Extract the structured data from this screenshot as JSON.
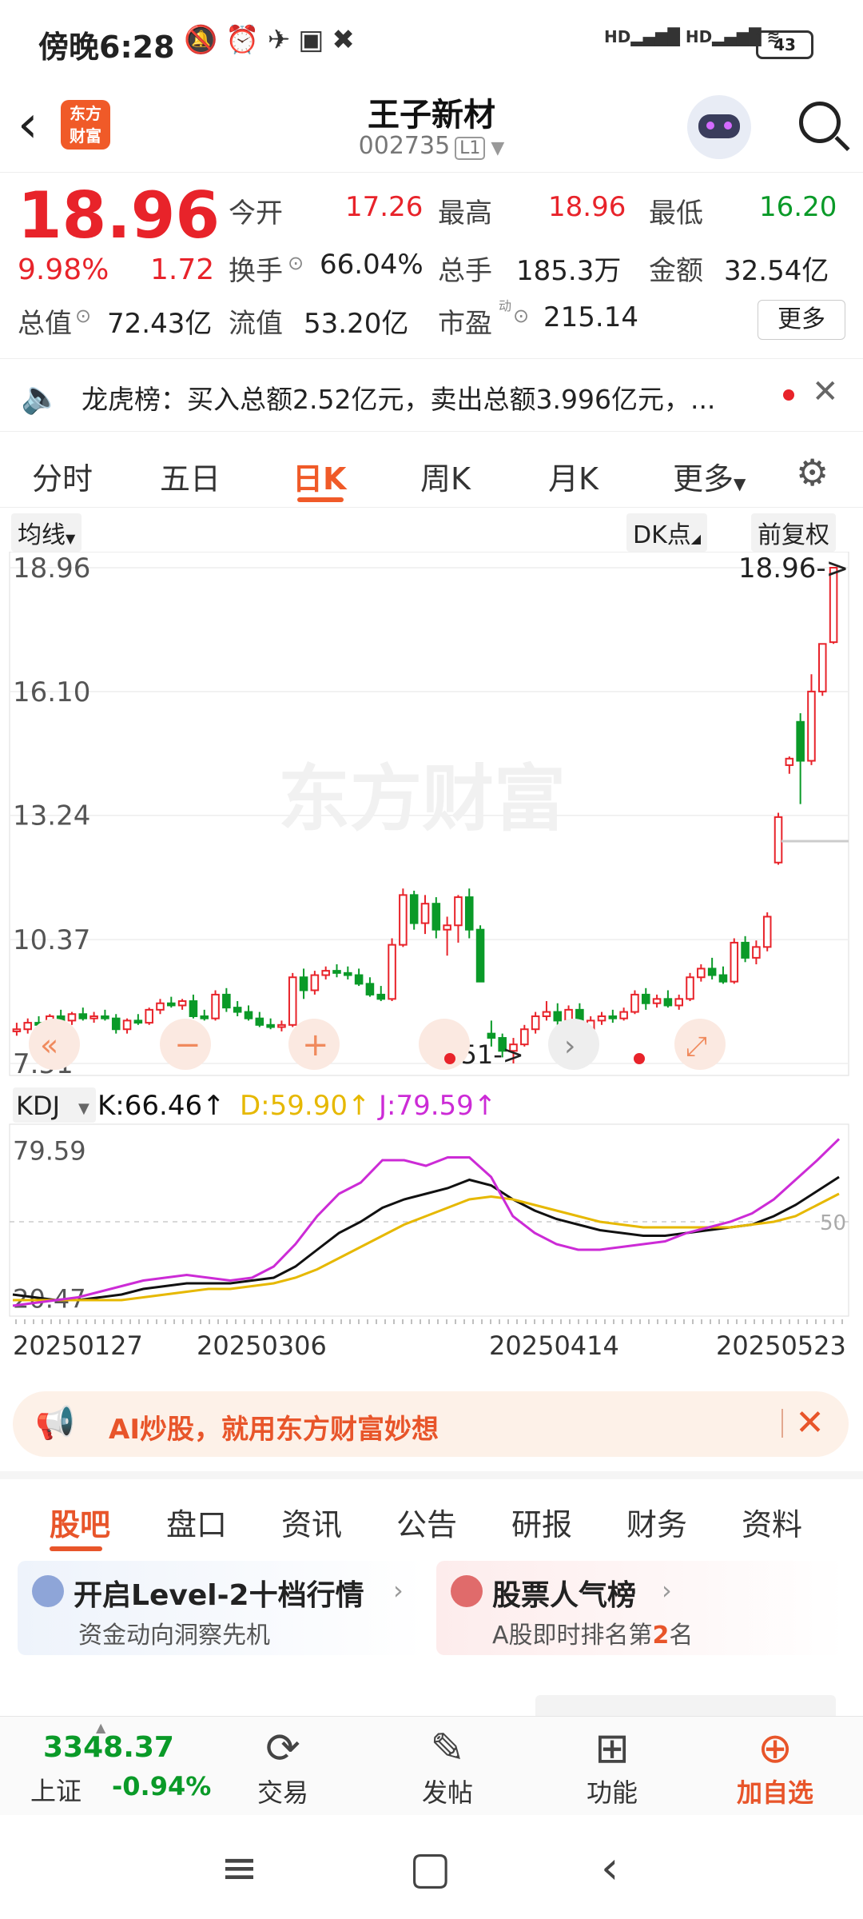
{
  "status_bar": {
    "time": "傍晚6:28",
    "battery": "43",
    "network": "HD HD"
  },
  "header": {
    "stock_name": "王子新材",
    "code": "002735",
    "level": "L1",
    "logo_text": "东方财富"
  },
  "quote": {
    "price": "18.96",
    "change_pct": "9.98%",
    "change": "1.72",
    "open_label": "今开",
    "open": "17.26",
    "high_label": "最高",
    "high": "18.96",
    "low_label": "最低",
    "low": "16.20",
    "turnover_label": "换手",
    "turnover": "66.04%",
    "volume_label": "总手",
    "volume": "185.3万",
    "amount_label": "金额",
    "amount": "32.54亿",
    "mktcap_label": "总值",
    "mktcap": "72.43亿",
    "float_label": "流值",
    "float": "53.20亿",
    "pe_label": "市盈",
    "pe_sup": "动",
    "pe": "215.14",
    "more_button": "更多"
  },
  "notice": {
    "text": "龙虎榜：买入总额2.52亿元，卖出总额3.996亿元，..."
  },
  "chart_tabs": [
    "分时",
    "五日",
    "日K",
    "周K",
    "月K",
    "更多"
  ],
  "active_chart_tab": "日K",
  "chart_controls": {
    "ma_button": "均线",
    "dk_button": "DK点",
    "adjust_button": "前复权"
  },
  "chart_data": [
    {
      "type": "candlestick",
      "y_ticks": [
        "18.96",
        "16.10",
        "13.24",
        "10.37",
        "7.51"
      ],
      "ylim": [
        7.51,
        18.96
      ],
      "max_marker": "18.96->",
      "min_marker": "7.51->",
      "watermark": "东方财富",
      "colors": {
        "up": "#e8232a",
        "down": "#0a9a28"
      },
      "candles": [
        [
          8.25,
          8.45,
          8.15,
          8.3
        ],
        [
          8.3,
          8.55,
          8.2,
          8.45
        ],
        [
          8.45,
          8.6,
          8.35,
          8.4
        ],
        [
          8.4,
          8.65,
          8.35,
          8.6
        ],
        [
          8.6,
          8.75,
          8.45,
          8.5
        ],
        [
          8.5,
          8.7,
          8.4,
          8.65
        ],
        [
          8.65,
          8.8,
          8.5,
          8.55
        ],
        [
          8.55,
          8.7,
          8.45,
          8.6
        ],
        [
          8.6,
          8.75,
          8.5,
          8.55
        ],
        [
          8.55,
          8.65,
          8.2,
          8.3
        ],
        [
          8.3,
          8.55,
          8.2,
          8.5
        ],
        [
          8.5,
          8.65,
          8.4,
          8.45
        ],
        [
          8.45,
          8.8,
          8.4,
          8.75
        ],
        [
          8.75,
          9.0,
          8.65,
          8.9
        ],
        [
          8.9,
          9.05,
          8.8,
          8.85
        ],
        [
          8.85,
          9.0,
          8.75,
          8.95
        ],
        [
          8.95,
          9.1,
          8.55,
          8.6
        ],
        [
          8.6,
          8.75,
          8.5,
          8.55
        ],
        [
          8.55,
          9.2,
          8.5,
          9.1
        ],
        [
          9.1,
          9.25,
          8.7,
          8.8
        ],
        [
          8.8,
          8.95,
          8.6,
          8.7
        ],
        [
          8.7,
          8.85,
          8.5,
          8.55
        ],
        [
          8.55,
          8.7,
          8.35,
          8.4
        ],
        [
          8.4,
          8.55,
          8.3,
          8.35
        ],
        [
          8.35,
          8.5,
          8.25,
          8.4
        ],
        [
          8.4,
          9.6,
          8.35,
          9.5
        ],
        [
          9.5,
          9.7,
          9.0,
          9.2
        ],
        [
          9.2,
          9.65,
          9.1,
          9.55
        ],
        [
          9.55,
          9.75,
          9.45,
          9.65
        ],
        [
          9.65,
          9.8,
          9.5,
          9.6
        ],
        [
          9.6,
          9.75,
          9.45,
          9.55
        ],
        [
          9.55,
          9.7,
          9.3,
          9.35
        ],
        [
          9.35,
          9.5,
          9.05,
          9.1
        ],
        [
          9.1,
          9.3,
          8.95,
          9.0
        ],
        [
          9.0,
          10.4,
          8.95,
          10.25
        ],
        [
          10.25,
          11.55,
          10.2,
          11.4
        ],
        [
          11.4,
          11.5,
          10.6,
          10.75
        ],
        [
          10.75,
          11.4,
          10.5,
          11.2
        ],
        [
          11.2,
          11.35,
          10.4,
          10.6
        ],
        [
          10.6,
          10.9,
          10.0,
          10.7
        ],
        [
          10.7,
          11.4,
          10.3,
          11.35
        ],
        [
          11.35,
          11.55,
          10.4,
          10.6
        ],
        [
          10.6,
          10.7,
          9.5,
          9.4
        ],
        [
          8.2,
          8.5,
          7.9,
          8.1
        ],
        [
          8.1,
          8.2,
          7.65,
          7.8
        ],
        [
          7.8,
          8.1,
          7.51,
          7.95
        ],
        [
          7.95,
          8.4,
          7.9,
          8.3
        ],
        [
          8.3,
          8.7,
          8.2,
          8.6
        ],
        [
          8.6,
          8.95,
          8.5,
          8.7
        ],
        [
          8.7,
          8.9,
          8.4,
          8.5
        ],
        [
          8.5,
          8.85,
          8.4,
          8.75
        ],
        [
          8.75,
          8.9,
          8.2,
          8.3
        ],
        [
          8.3,
          8.6,
          8.25,
          8.5
        ],
        [
          8.5,
          8.7,
          8.4,
          8.6
        ],
        [
          8.6,
          8.75,
          8.45,
          8.55
        ],
        [
          8.55,
          8.8,
          8.5,
          8.7
        ],
        [
          8.7,
          9.2,
          8.65,
          9.1
        ],
        [
          9.1,
          9.25,
          8.75,
          8.9
        ],
        [
          8.9,
          9.1,
          8.8,
          9.0
        ],
        [
          9.0,
          9.2,
          8.8,
          8.85
        ],
        [
          8.85,
          9.1,
          8.75,
          9.0
        ],
        [
          9.0,
          9.6,
          8.95,
          9.5
        ],
        [
          9.5,
          9.8,
          9.4,
          9.7
        ],
        [
          9.7,
          9.95,
          9.45,
          9.55
        ],
        [
          9.55,
          9.75,
          9.35,
          9.4
        ],
        [
          9.4,
          10.4,
          9.35,
          10.3
        ],
        [
          10.3,
          10.45,
          9.85,
          9.95
        ],
        [
          9.95,
          10.35,
          9.8,
          10.2
        ],
        [
          10.2,
          11.0,
          10.1,
          10.9
        ],
        [
          12.15,
          13.3,
          12.1,
          13.2
        ],
        [
          14.4,
          14.6,
          14.2,
          14.55
        ],
        [
          15.4,
          15.6,
          13.5,
          14.5
        ],
        [
          14.5,
          16.5,
          14.4,
          16.1
        ],
        [
          16.1,
          17.2,
          16.0,
          17.2
        ],
        [
          17.24,
          18.96,
          17.2,
          18.96
        ]
      ]
    },
    {
      "type": "line",
      "indicator": "KDJ",
      "y_ticks": [
        "79.59",
        "50",
        "20.47"
      ],
      "ylim": [
        18,
        82
      ],
      "x_ticks": [
        "20250127",
        "20250306",
        "20250414",
        "20250523"
      ],
      "series": [
        {
          "name": "K",
          "value_label": "K:66.46",
          "color": "#111111",
          "values": [
            24,
            23,
            22,
            22,
            23,
            24,
            26,
            27,
            28,
            28,
            28,
            29,
            30,
            34,
            40,
            46,
            50,
            55,
            58,
            60,
            62,
            65,
            63,
            58,
            54,
            51,
            49,
            47,
            46,
            45,
            45,
            46,
            47,
            48,
            49,
            52,
            56,
            61,
            66
          ]
        },
        {
          "name": "D",
          "value_label": "D:59.90",
          "color": "#e6b800",
          "values": [
            22,
            22,
            22,
            22,
            22,
            22,
            23,
            24,
            25,
            26,
            26,
            27,
            28,
            30,
            33,
            37,
            41,
            45,
            49,
            52,
            55,
            58,
            59,
            58,
            56,
            54,
            52,
            50,
            49,
            48,
            48,
            48,
            48,
            48,
            49,
            50,
            52,
            56,
            60
          ]
        },
        {
          "name": "J",
          "value_label": "J:79.59",
          "color": "#cc2bd6",
          "values": [
            20,
            21,
            22,
            23,
            25,
            27,
            29,
            30,
            31,
            30,
            29,
            30,
            34,
            42,
            52,
            60,
            64,
            72,
            72,
            70,
            73,
            73,
            66,
            52,
            46,
            42,
            40,
            40,
            41,
            42,
            43,
            46,
            48,
            50,
            53,
            58,
            65,
            72,
            79.59
          ]
        }
      ]
    }
  ],
  "ai_banner": {
    "text": "AI炒股，就用东方财富妙想"
  },
  "sub_tabs": [
    "股吧",
    "盘口",
    "资讯",
    "公告",
    "研报",
    "财务",
    "资料"
  ],
  "active_sub_tab": "股吧",
  "cards": [
    {
      "title": "开启Level-2十档行情",
      "subtitle": "资金动向洞察先机"
    },
    {
      "title": "股票人气榜",
      "subtitle_prefix": "A股即时排名第",
      "rank": "2",
      "subtitle_suffix": "名"
    }
  ],
  "bottom_bar": {
    "index_value": "3348.37",
    "index_name": "上证",
    "index_change": "-0.94%",
    "items": [
      "交易",
      "发帖",
      "功能",
      "加自选"
    ]
  }
}
